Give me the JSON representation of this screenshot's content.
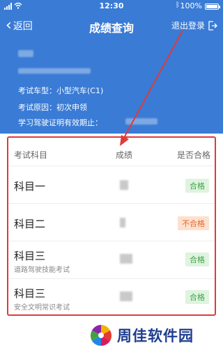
{
  "status_bar": {
    "time": "12:30",
    "battery": "100%"
  },
  "header": {
    "back_label": "返回",
    "title": "成绩查询",
    "logout_label": "退出登录"
  },
  "info": {
    "vehicle_type_label": "考试车型：小型汽车(C1)",
    "exam_reason_label": "考试原因：初次申领",
    "cert_validity_label": "学习驾驶证明有效期止："
  },
  "table": {
    "headers": {
      "subject": "考试科目",
      "score": "成绩",
      "pass": "是否合格"
    },
    "rows": [
      {
        "subject": "科目一",
        "desc": "",
        "result": "合格"
      },
      {
        "subject": "科目二",
        "desc": "",
        "result": "不合格"
      },
      {
        "subject": "科目三",
        "desc": "道路驾驶技能考试",
        "result": "合格"
      },
      {
        "subject": "科目三",
        "desc": "安全文明常识考试",
        "result": "合格"
      }
    ]
  },
  "watermark": {
    "text": "周佳软件园"
  },
  "colors": {
    "brand_blue": "#3a7bd5",
    "pass_green": "#3aa54a",
    "fail_orange": "#e36a2a",
    "highlight_red": "#e03a3a"
  }
}
